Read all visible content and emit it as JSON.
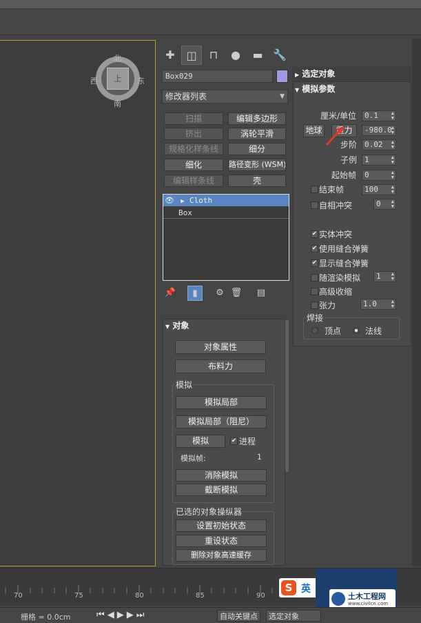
{
  "viewcube": {
    "north": "北",
    "south": "南",
    "east": "东",
    "west": "西",
    "face": "上"
  },
  "object": {
    "name": "Box029",
    "color": "#a09ae0"
  },
  "modifier_list": {
    "label": "修改器列表"
  },
  "modifier_buttons": [
    {
      "label": "扫描",
      "enabled": false
    },
    {
      "label": "编辑多边形",
      "enabled": true
    },
    {
      "label": "挤出",
      "enabled": false
    },
    {
      "label": "涡轮平滑",
      "enabled": true
    },
    {
      "label": "规格化样条线",
      "enabled": false
    },
    {
      "label": "细分",
      "enabled": true
    },
    {
      "label": "细化",
      "enabled": true
    },
    {
      "label": "路径变形 (WSM)",
      "enabled": true
    },
    {
      "label": "编辑样条线",
      "enabled": false
    },
    {
      "label": "壳",
      "enabled": true
    }
  ],
  "stack": {
    "items": [
      "Cloth",
      "Box"
    ]
  },
  "object_rollout": {
    "title": "对象",
    "object_props": "对象属性",
    "cloth_forces": "布料力",
    "simulate_group": "模拟",
    "sim_local": "模拟局部",
    "sim_local_damped": "模拟局部（阻尼）",
    "simulate": "模拟",
    "progress": "进程",
    "sim_frame_label": "模拟帧:",
    "sim_frame_value": "1",
    "erase_sim": "消除模拟",
    "truncate_sim": "截断模拟",
    "selected_group": "已选的对象操纵器",
    "set_initial": "设置初始状态",
    "reset_state": "重设状态",
    "delete_cache": "删除对象高速缓存"
  },
  "selected_object_rollout": {
    "title": "选定对象"
  },
  "sim_params": {
    "title": "模拟参数",
    "cm_unit_label": "厘米/单位",
    "cm_unit_value": "0.1",
    "earth_button": "地球",
    "gravity_label": "重力",
    "gravity_value": "-980.0",
    "step_label": "步阶",
    "step_value": "0.02",
    "subsample_label": "子例",
    "subsample_value": "1",
    "start_frame_label": "起始帧",
    "start_frame_value": "0",
    "end_frame_label": "结束帧",
    "end_frame_value": "100",
    "self_collision_label": "自相冲突",
    "self_collision_value": "0",
    "solid_collision": "实体冲突",
    "use_sewing": "使用缝合弹簧",
    "show_sewing": "显示缝合弹簧",
    "render_sim": "随渲染模拟",
    "render_sim_value": "1",
    "adv_pinch": "高级收缩",
    "tension_label": "张力",
    "tension_value": "1.0",
    "weld_group": "焊接",
    "vertex": "顶点",
    "normal": "法线"
  },
  "timeline": {
    "ticks": [
      "70",
      "75",
      "80",
      "85",
      "90"
    ]
  },
  "statusbar": {
    "grid": "栅格 = 0.0cm",
    "auto_key": "自动关键点",
    "selected": "选定对象"
  },
  "watermark": {
    "text": "土木工程网",
    "url": "www.civilcn.com"
  },
  "ime": {
    "label": "英"
  }
}
